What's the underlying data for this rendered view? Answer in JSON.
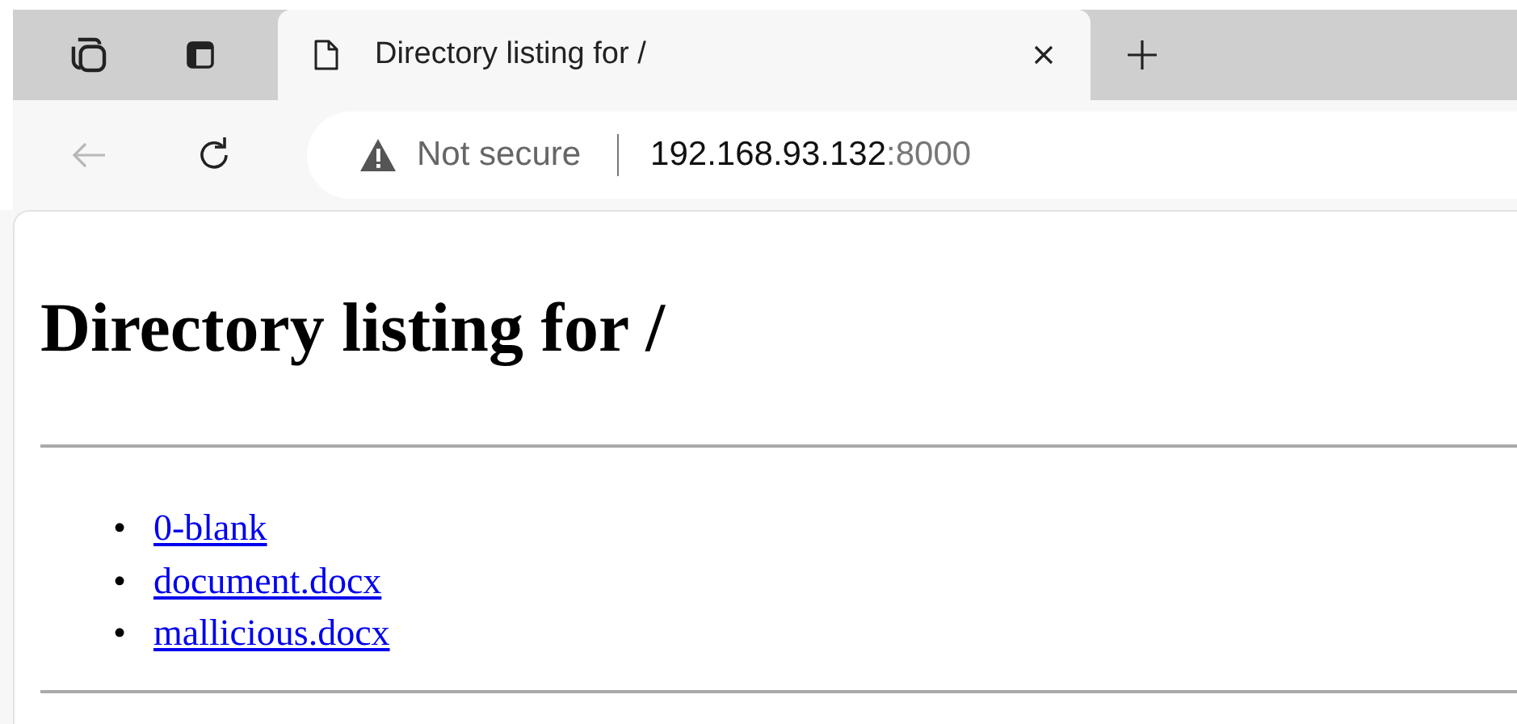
{
  "browser": {
    "tabs": [
      {
        "title": "Directory listing for /",
        "selected": true
      }
    ],
    "address": {
      "security": "Not secure",
      "host": "192.168.93.132",
      "port": ":8000"
    }
  },
  "page": {
    "heading": "Directory listing for /",
    "links": [
      {
        "marker": "•",
        "text": "0-blank"
      },
      {
        "marker": "•",
        "text": "document.docx"
      },
      {
        "marker": "•",
        "text": "mallicious.docx"
      }
    ]
  }
}
